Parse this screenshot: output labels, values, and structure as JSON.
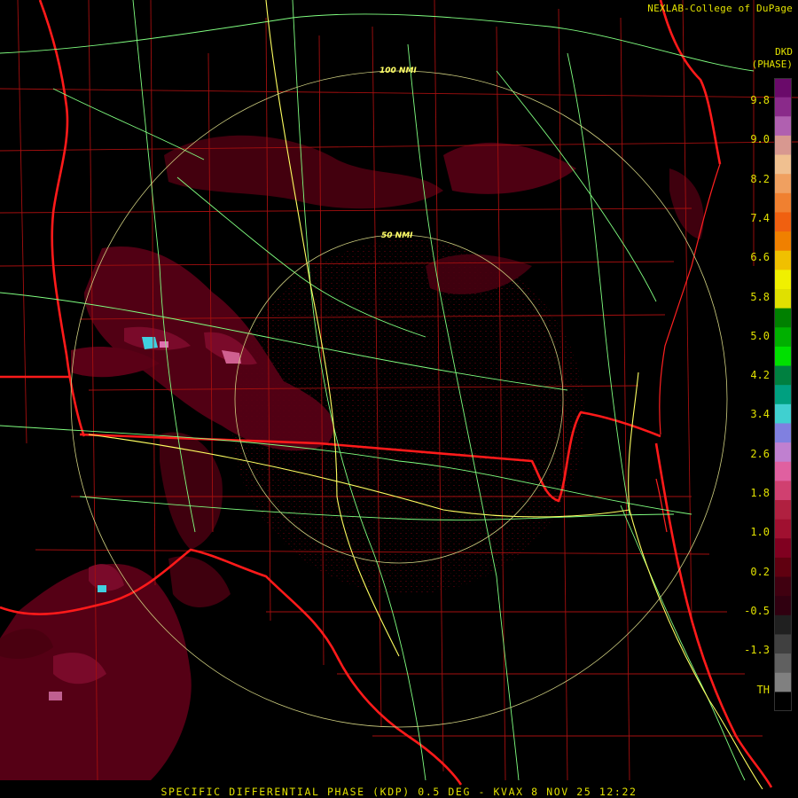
{
  "credit": "NEXLAB-College of DuPage",
  "product": {
    "code": "DKD",
    "unit": "(PHASE)"
  },
  "footer": "SPECIFIC DIFFERENTIAL PHASE (KDP) 0.5 DEG - KVAX 8 NOV 25 12:22",
  "ring_labels": [
    "100 NMI",
    "50 NMI"
  ],
  "scale": {
    "labels": [
      "9.8",
      "9.0",
      "8.2",
      "7.4",
      "6.6",
      "5.8",
      "5.0",
      "4.2",
      "3.4",
      "2.6",
      "1.8",
      "1.0",
      "0.2",
      "-0.5",
      "-1.3",
      "TH"
    ],
    "colors": [
      "#6a0a6a",
      "#8a2a8a",
      "#b060b0",
      "#d89890",
      "#f0c090",
      "#f0a060",
      "#f08030",
      "#f06010",
      "#f08000",
      "#f0c000",
      "#f0f000",
      "#e0e000",
      "#008000",
      "#00b000",
      "#00e000",
      "#008040",
      "#00a080",
      "#40d0d0",
      "#8080e0",
      "#c080d0",
      "#e060a0",
      "#d04070",
      "#b02040",
      "#a01030",
      "#800020",
      "#600010",
      "#400010",
      "#300010",
      "#202020",
      "#404040",
      "#606060",
      "#808080",
      "#000000"
    ]
  },
  "colors": {
    "state_border": "#ff1a1a",
    "county_line": "#b01010",
    "highway": "#80ff80",
    "interstate": "#ffff60",
    "ring": "#d0d080"
  }
}
